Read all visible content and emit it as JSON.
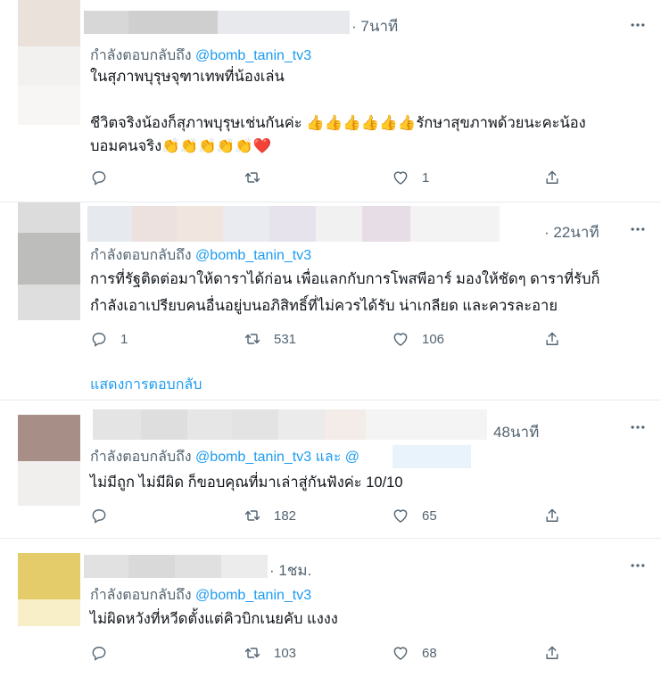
{
  "colors": {
    "accent": "#1d9bf0",
    "muted": "#536471",
    "text": "#0f1419",
    "heart": "#e0245e"
  },
  "replies": [
    {
      "time": "· 7นาที",
      "replying_label": "กำลังตอบกลับถึง",
      "handle": "@bomb_tanin_tv3",
      "lines": [
        "ในสุภาพบุรุษจุฑาเทพที่น้องเล่น",
        "",
        "ชีวิตจริงน้องก็สุภาพบุรุษเช่นกันค่ะ 👍👍👍👍👍👍รักษาสุขภาพด้วยนะคะน้อง",
        "บอมคนจริง👏👏👏👏👏❤️"
      ],
      "reply_count": "",
      "retweet_count": "",
      "like_count": "1"
    },
    {
      "time": "· 22นาที",
      "replying_label": "กำลังตอบกลับถึง",
      "handle": "@bomb_tanin_tv3",
      "lines": [
        "การที่รัฐติดต่อมาให้ดาราได้ก่อน เพื่อแลกกับการโพสพีอาร์ มองให้ชัดๆ ดาราที่รับก็",
        "กำลังเอาเปรียบคนอื่นอยู่บนอภิสิทธิ์ที่ไม่ควรได้รับ น่าเกลียด และควรละอาย"
      ],
      "reply_count": "1",
      "retweet_count": "531",
      "like_count": "106"
    },
    {
      "time": "48นาที",
      "replying_label": "กำลังตอบกลับถึง",
      "handle": "@bomb_tanin_tv3",
      "and_label": "และ",
      "second_handle": "@",
      "lines": [
        "ไม่มีถูก ไม่มีผิด ก็ขอบคุณที่มาเล่าสู่กันฟังค่ะ 10/10"
      ],
      "reply_count": "",
      "retweet_count": "182",
      "like_count": "65"
    },
    {
      "time": "· 1ชม.",
      "replying_label": "กำลังตอบกลับถึง",
      "handle": "@bomb_tanin_tv3",
      "lines": [
        "ไม่ผิดหวังที่หวีดตั้งแต่คิวบิกเนยคับ แงงง"
      ],
      "reply_count": "",
      "retweet_count": "103",
      "like_count": "68"
    }
  ],
  "show_replies_label": "แสดงการตอบกลับ"
}
